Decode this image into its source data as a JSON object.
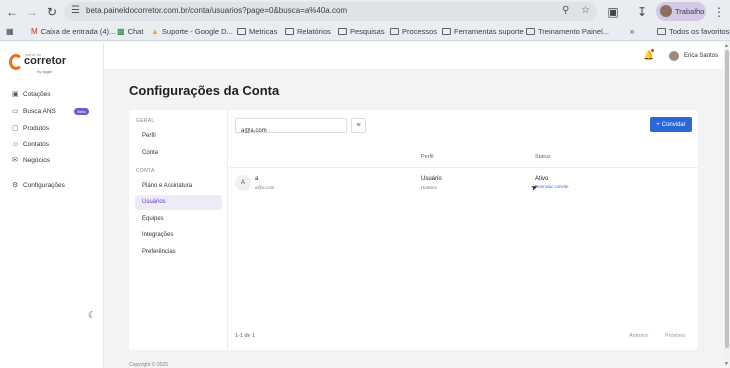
{
  "browser": {
    "url": "beta.painel​docorretor.com.br/conta/usuarios?page=0&busca=a%40a.com",
    "profile_label": "Trabalho",
    "bookmarks": [
      {
        "label": "Caixa de entrada (4)...",
        "icon": "gmail-icon"
      },
      {
        "label": "Chat",
        "icon": "chat-icon"
      },
      {
        "label": "Suporte - Google D...",
        "icon": "drive-icon"
      },
      {
        "label": "Metricas",
        "icon": "folder-icon"
      },
      {
        "label": "Relatórios",
        "icon": "folder-icon"
      },
      {
        "label": "Pesquisas",
        "icon": "folder-icon"
      },
      {
        "label": "Processos",
        "icon": "folder-icon"
      },
      {
        "label": "Ferramentas suporte",
        "icon": "folder-icon"
      },
      {
        "label": "Treinamento Painel...",
        "icon": "folder-icon"
      }
    ],
    "all_favorites": "Todos os favoritos"
  },
  "logo": {
    "small_text": "painel do",
    "brand": "corretor",
    "by": "by agger"
  },
  "sidebar": {
    "items": [
      {
        "label": "Cotações",
        "icon": "wallet-icon"
      },
      {
        "label": "Busca ANS",
        "icon": "folder-icon",
        "badge": "Beta"
      },
      {
        "label": "Produtos",
        "icon": "box-icon"
      },
      {
        "label": "Contatos",
        "icon": "person-icon"
      },
      {
        "label": "Negócios",
        "icon": "briefcase-icon"
      },
      {
        "label": "Configurações",
        "icon": "gear-icon"
      }
    ]
  },
  "topbar": {
    "user_name": "Erica Santos"
  },
  "page": {
    "title": "Configurações da Conta"
  },
  "subnav": {
    "group_geral": "GERAL",
    "geral_items": [
      "Perfil",
      "Conta"
    ],
    "group_conta": "CONTA",
    "conta_items": [
      "Plano e Assinatura",
      "Usuários",
      "Equipes",
      "Integrações",
      "Preferências"
    ],
    "active": "Usuários"
  },
  "toolbar": {
    "search_value": "a@a.com",
    "invite_label": "Convidar"
  },
  "table": {
    "headers": {
      "profile": "Perfil",
      "status": "Status"
    },
    "rows": [
      {
        "initial": "A",
        "name": "a",
        "email": "a@a.com",
        "profile": "Usuário",
        "team": "Hunters",
        "status": "Ativo",
        "action": "Reenviar convite"
      }
    ]
  },
  "pagination": {
    "count": "1-1 de 1",
    "prev": "Anterior",
    "next": "Próximo"
  },
  "footer": {
    "text": "Copyright © 2025"
  },
  "colors": {
    "brand_orange": "#e8711a",
    "primary_blue": "#2968d6",
    "active_purple": "#5b3fc0"
  }
}
